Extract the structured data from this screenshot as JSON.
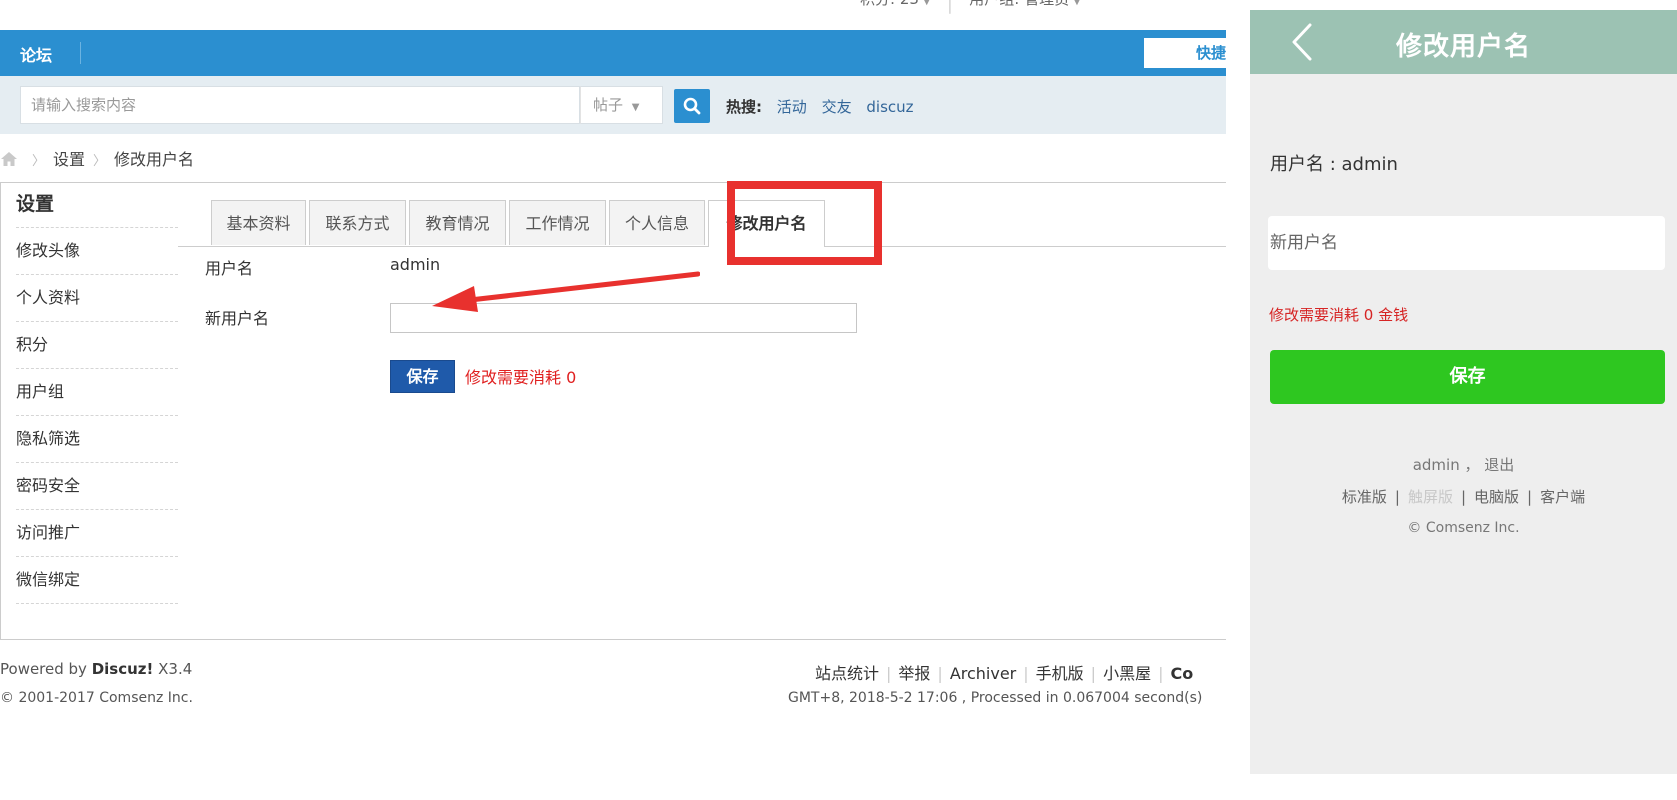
{
  "top_info": {
    "credits": "积分: 23",
    "user_group": "用户组: 管理员"
  },
  "navbar": {
    "brand": "论坛",
    "quick": "快捷"
  },
  "search": {
    "placeholder": "请输入搜索内容",
    "type": "帖子",
    "hot_label": "热搜:",
    "hot_words": [
      "活动",
      "交友",
      "discuz"
    ]
  },
  "breadcrumb": {
    "items": [
      "设置",
      "修改用户名"
    ]
  },
  "sidebar": {
    "title": "设置",
    "items": [
      "修改头像",
      "个人资料",
      "积分",
      "用户组",
      "隐私筛选",
      "密码安全",
      "访问推广",
      "微信绑定"
    ]
  },
  "tabs": [
    "基本资料",
    "联系方式",
    "教育情况",
    "工作情况",
    "个人信息",
    "修改用户名"
  ],
  "form": {
    "username_label": "用户名",
    "username_value": "admin",
    "new_username_label": "新用户名",
    "new_username_value": "",
    "save_label": "保存",
    "cost_note": "修改需要消耗 0"
  },
  "footer": {
    "powered_prefix": "Powered by ",
    "powered_brand": "Discuz!",
    "powered_version": " X3.4",
    "copyright": "© 2001-2017 Comsenz Inc.",
    "links": [
      "站点统计",
      "举报",
      "Archiver",
      "手机版",
      "小黑屋",
      "Co"
    ],
    "time_info": "GMT+8, 2018-5-2 17:06 , Processed in 0.067004 second(s)"
  },
  "mobile": {
    "title": "修改用户名",
    "username_line": "用户名 : admin",
    "new_username_placeholder": "新用户名",
    "cost_note": "修改需要消耗 0 金钱",
    "save_label": "保存",
    "footer_user": "admin ， 退出",
    "footer_versions": [
      "标准版",
      "触屏版",
      "电脑版",
      "客户端"
    ],
    "footer_copyright": "© Comsenz Inc."
  },
  "colors": {
    "nav_blue": "#2b8fd0",
    "highlight_red": "#e8312e",
    "save_blue": "#1f5aaa",
    "mobile_header": "#9cc2b3",
    "mobile_save_green": "#2ec720"
  },
  "icons": [
    "home-icon",
    "search-icon",
    "back-chevron-icon",
    "dropdown-caret-icon",
    "annotation-arrow"
  ]
}
